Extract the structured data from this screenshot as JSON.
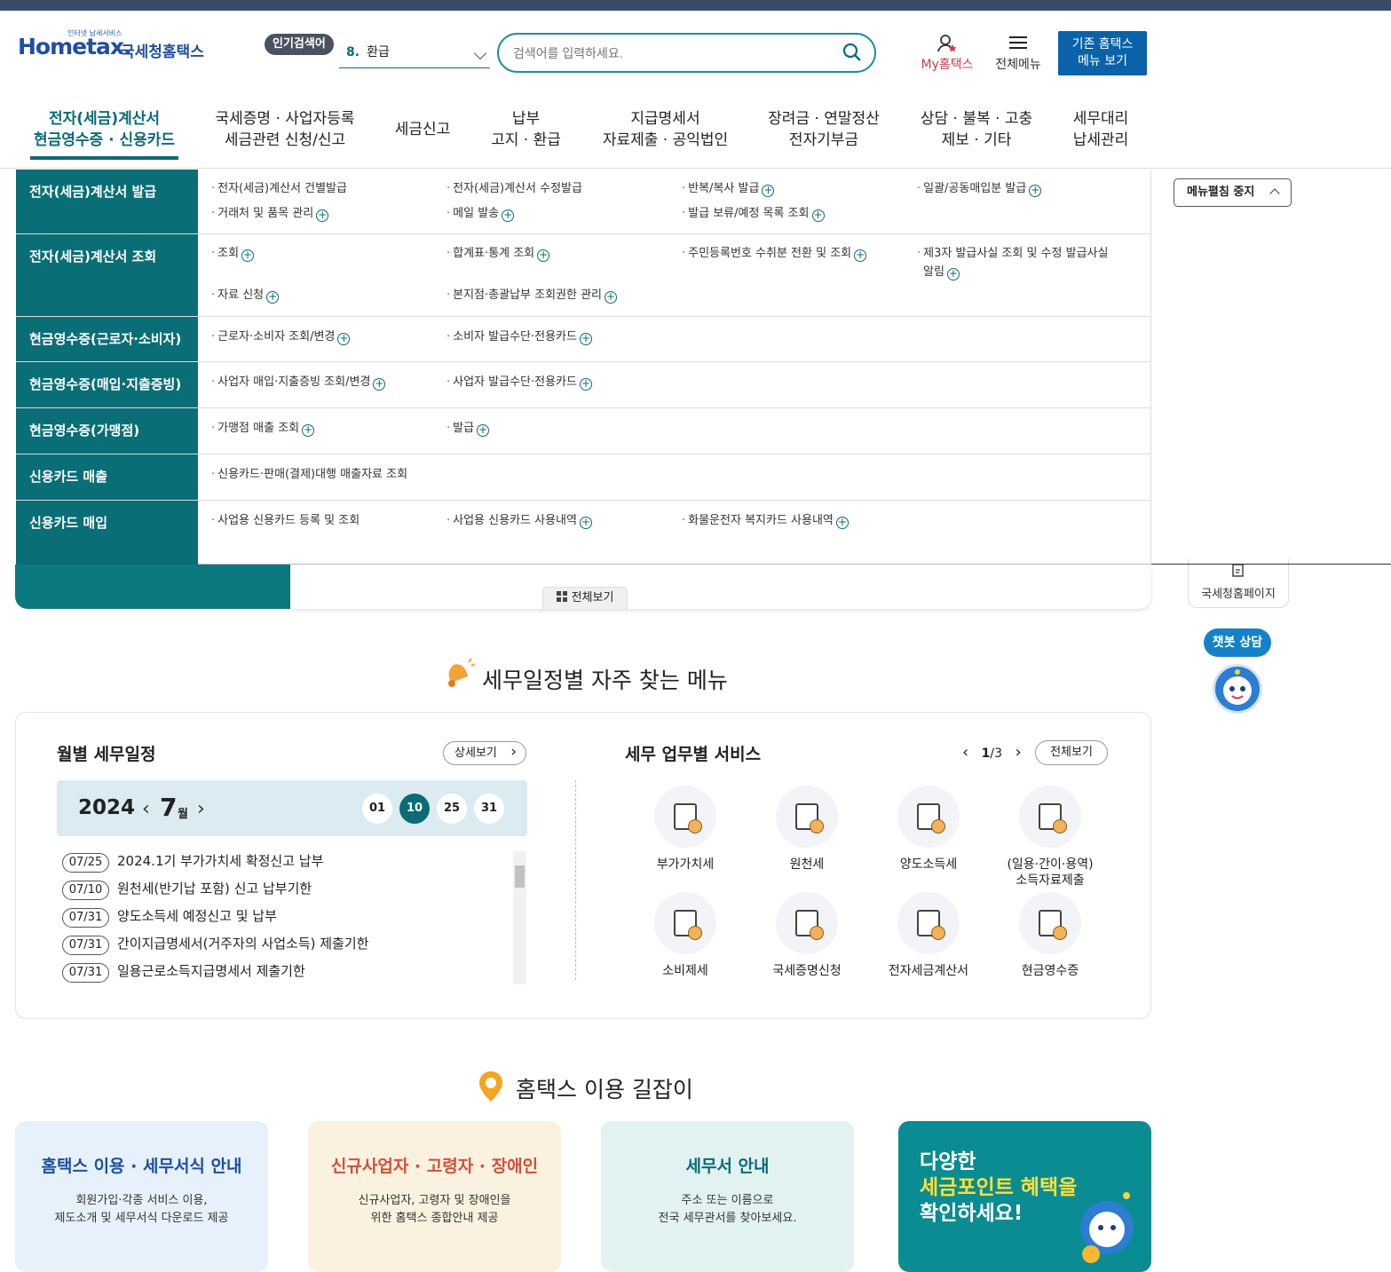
{
  "header": {
    "logo_small": "인터넷 납세서비스",
    "logo_main": "Hometax.",
    "logo_sub": "국세청홈택스",
    "popular_badge": "인기검색어",
    "popular_rank": "8.",
    "popular_term": "환급",
    "search_placeholder": "검색어를 입력하세요.",
    "my_hometax": "My홈택스",
    "all_menu": "전체메뉴",
    "old_menu_line1": "기존 홈택스",
    "old_menu_line2": "메뉴 보기"
  },
  "gnb": [
    {
      "l1": "전자(세금)계산서",
      "l2": "현금영수증 · 신용카드"
    },
    {
      "l1": "국세증명 · 사업자등록",
      "l2": "세금관련 신청/신고"
    },
    {
      "l1": "세금신고",
      "l2": ""
    },
    {
      "l1": "납부",
      "l2": "고지 · 환급"
    },
    {
      "l1": "지급명세서",
      "l2": "자료제출 · 공익법인"
    },
    {
      "l1": "장려금 · 연말정산",
      "l2": "전자기부금"
    },
    {
      "l1": "상담 · 불복 · 고충",
      "l2": "제보 · 기타"
    },
    {
      "l1": "세무대리",
      "l2": "납세관리"
    }
  ],
  "mega": {
    "rows": [
      {
        "cat": "전자(세금)계산서 발급",
        "links": [
          "전자(세금)계산서 건별발급",
          "전자(세금)계산서 수정발급",
          "반복/복사 발급",
          "일괄/공동매입분 발급",
          "거래처 및 품목 관리",
          "메일 발송",
          "발급 보류/예정 목록 조회"
        ]
      },
      {
        "cat": "전자(세금)계산서 조회",
        "links": [
          "조회",
          "합계표·통계 조회",
          "주민등록번호 수취분 전환 및 조회",
          "제3자 발급사실 조회 및 수정 발급사실",
          "알림",
          "자료 신청",
          "본지점·총괄납부 조회권한 관리"
        ]
      },
      {
        "cat": "현금영수증(근로자·소비자)",
        "links": [
          "근로자·소비자 조회/변경",
          "소비자 발급수단·전용카드"
        ]
      },
      {
        "cat": "현금영수증(매입·지출증빙)",
        "links": [
          "사업자 매입·지출증빙 조회/변경",
          "사업자 발급수단·전용카드"
        ]
      },
      {
        "cat": "현금영수증(가맹점)",
        "links": [
          "가맹점 매출 조회",
          "발급"
        ]
      },
      {
        "cat": "신용카드 매출",
        "links": [
          "신용카드·판매(결제)대행 매출자료 조회"
        ]
      },
      {
        "cat": "신용카드 매입",
        "links": [
          "사업용 신용카드 등록 및 조회",
          "사업용 신용카드 사용내역",
          "화물운전자 복지카드 사용내역"
        ]
      }
    ],
    "stop_label": "메뉴펼침 중지"
  },
  "side": {
    "view_all": "전체보기",
    "nts_page": "국세청홈페이지",
    "chatbot": "챗봇 상담"
  },
  "schedule_section": {
    "title": "세무일정별 자주 찾는 메뉴",
    "monthly_title": "월별 세무일정",
    "detail_label": "상세보기",
    "year": "2024",
    "month": "7",
    "month_unit": "월",
    "days": [
      "01",
      "10",
      "25",
      "31"
    ],
    "selected_day": "10",
    "items": [
      {
        "date": "07/25",
        "text": "2024.1기 부가가치세 확정신고 납부"
      },
      {
        "date": "07/10",
        "text": "원천세(반기납 포함) 신고 납부기한"
      },
      {
        "date": "07/31",
        "text": "양도소득세 예정신고 및 납부"
      },
      {
        "date": "07/31",
        "text": "간이지급명세서(거주자의 사업소득) 제출기한"
      },
      {
        "date": "07/31",
        "text": "일용근로소득지급명세서 제출기한"
      }
    ],
    "service_title": "세무 업무별 서비스",
    "page_current": "1",
    "page_total": "/3",
    "service_all": "전체보기",
    "services": [
      {
        "name": "부가가치세",
        "name2": ""
      },
      {
        "name": "원천세",
        "name2": ""
      },
      {
        "name": "양도소득세",
        "name2": ""
      },
      {
        "name": "(일용·간이·용역)",
        "name2": "소득자료제출"
      },
      {
        "name": "소비제세",
        "name2": ""
      },
      {
        "name": "국세증명신청",
        "name2": ""
      },
      {
        "name": "전자세금계산서",
        "name2": ""
      },
      {
        "name": "현금영수증",
        "name2": ""
      }
    ]
  },
  "guide_section": {
    "title": "홈택스 이용 길잡이",
    "cards": [
      {
        "title": "홈택스 이용 · 세무서식 안내",
        "line1": "회원가입·각종 서비스 이용,",
        "line2": "제도소개 및 세무서식 다운로드 제공"
      },
      {
        "title": "신규사업자 · 고령자 · 장애인",
        "line1": "신규사업자, 고령자 및 장애인을",
        "line2": "위한 홈택스 종합안내 제공"
      },
      {
        "title": "세무서 안내",
        "line1": "주소 또는 이름으로",
        "line2": "전국 세무관서를 찾아보세요."
      }
    ],
    "promo_line1": "다양한",
    "promo_line2": "세금포인트 혜택을",
    "promo_line3": "확인하세요!"
  },
  "colors": {
    "primary": "#0b6b76",
    "menu_cat": "#0a6e77",
    "accent_red": "#d23a4c",
    "button_blue": "#0a62a8"
  }
}
